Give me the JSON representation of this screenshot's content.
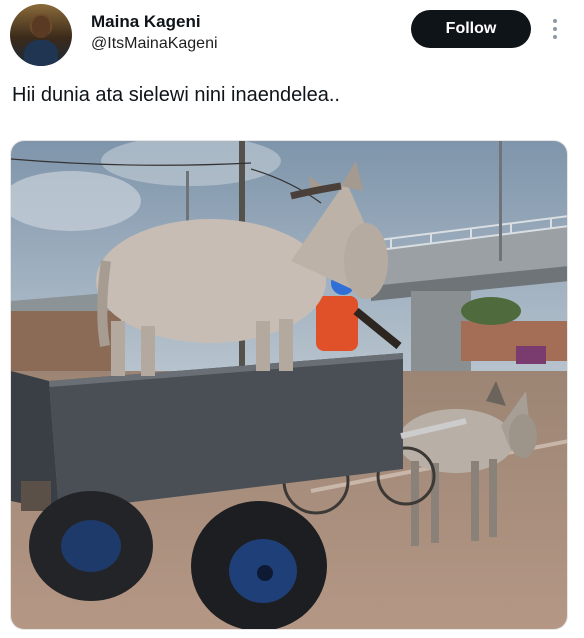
{
  "author": {
    "name": "Maina Kageni",
    "handle": "@ItsMainaKageni",
    "avatar_icon": "profile-photo"
  },
  "actions": {
    "follow_label": "Follow",
    "more_icon": "more-vertical-icon"
  },
  "tweet": {
    "text": "Hii dunia ata sielewi nini inaendelea.."
  },
  "media": {
    "type": "photo",
    "icon": "donkey-cart-photo"
  },
  "colors": {
    "follow_bg": "#0f1419",
    "follow_text": "#ffffff",
    "text_primary": "#0f1419",
    "sky": "#8ea3b8",
    "road": "#a88b78"
  }
}
